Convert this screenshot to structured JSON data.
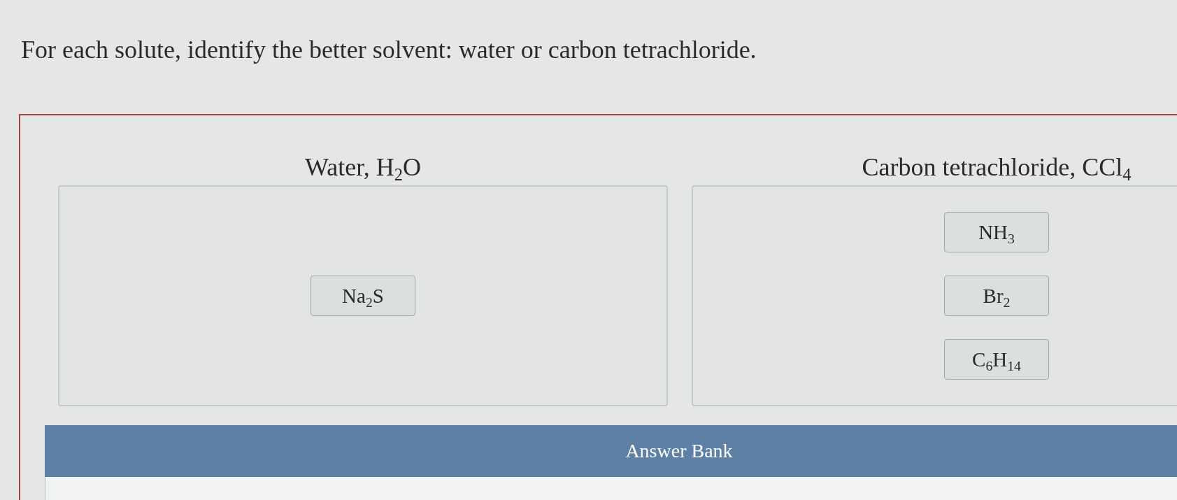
{
  "question": {
    "text": "For each solute, identify the better solvent: water or carbon tetrachloride."
  },
  "bins": [
    {
      "title": "Water, H$_{2}$O",
      "items": [
        "Na$_{2}$S"
      ]
    },
    {
      "title": "Carbon tetrachloride, CCl$_{4}$",
      "items": [
        "NH$_{3}$",
        "Br$_{2}$",
        "C$_{6}$H$_{14}$"
      ]
    }
  ],
  "answer_bank": {
    "title": "Answer Bank"
  }
}
